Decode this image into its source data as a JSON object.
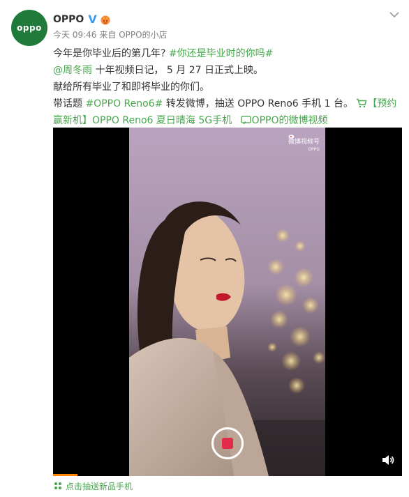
{
  "user": {
    "name": "OPPO",
    "avatar_text": "oppo",
    "verified_mark": "V",
    "time": "今天 09:46",
    "source": "来自 OPPO的小店"
  },
  "post": {
    "line1_text": "今年是你毕业后的第几年? ",
    "line1_topic": "#你还是毕业时的你吗#",
    "line2_mention": "@周冬雨",
    "line2_text": " 十年视频日记， 5 月 27 日正式上映。",
    "line3_text": "献给所有毕业了和即将毕业的你们。",
    "line4_prefix": "带话题 ",
    "line4_topic": "#OPPO Reno6#",
    "line4_text": " 转发微博，抽送 OPPO Reno6 手机 1 台。 ",
    "line4_link": "【预约",
    "line5_link": "赢新机】OPPO Reno6 夏日晴海 5G手机",
    "line5_video_link": "OPPO的微博视频"
  },
  "video": {
    "watermark_title": "微博视频号",
    "watermark_sub": "OPPO",
    "progress_fraction": 0.07
  },
  "footer": {
    "label": "点击抽送新品手机"
  },
  "icons": [
    "chevron-down-icon",
    "crown-icon",
    "cart-icon",
    "video-link-icon",
    "volume-icon",
    "sparkle-icon",
    "weibo-logo-icon"
  ],
  "colors": {
    "link_green": "#45a64c",
    "verified_blue": "#3a9bf0",
    "record_red": "#e32b4c",
    "progress_orange": "#ff8200"
  }
}
